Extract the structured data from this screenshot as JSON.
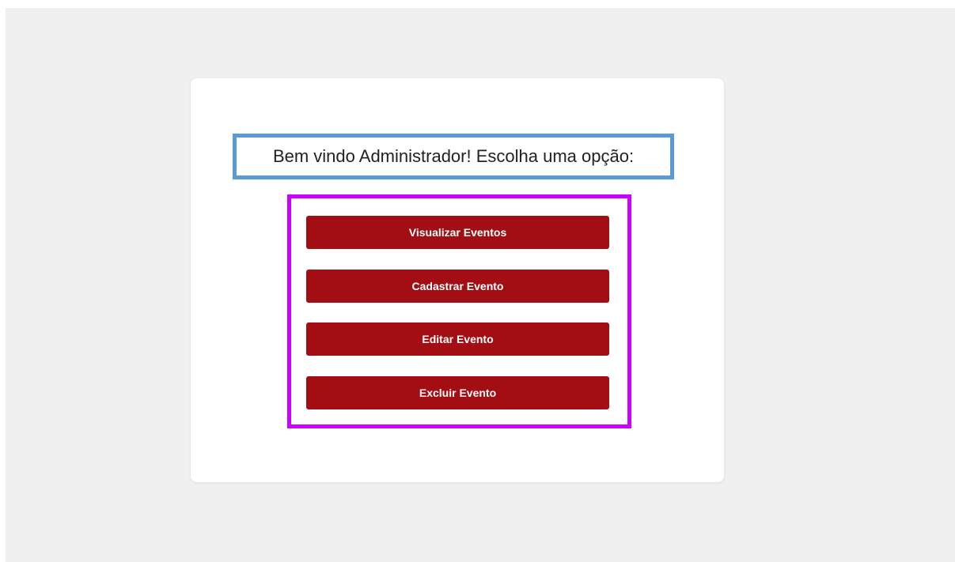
{
  "page": {
    "greeting": "Bem vindo Administrador! Escolha uma opção:"
  },
  "menu": {
    "buttons": [
      {
        "label": "Visualizar Eventos"
      },
      {
        "label": "Cadastrar Evento"
      },
      {
        "label": "Editar Evento"
      },
      {
        "label": "Excluir Evento"
      }
    ]
  },
  "colors": {
    "background": "#f0f0f0",
    "card": "#ffffff",
    "button": "#a30e14",
    "heading_outline": "#5b9bd5",
    "buttons_outline": "#cc00ff"
  }
}
